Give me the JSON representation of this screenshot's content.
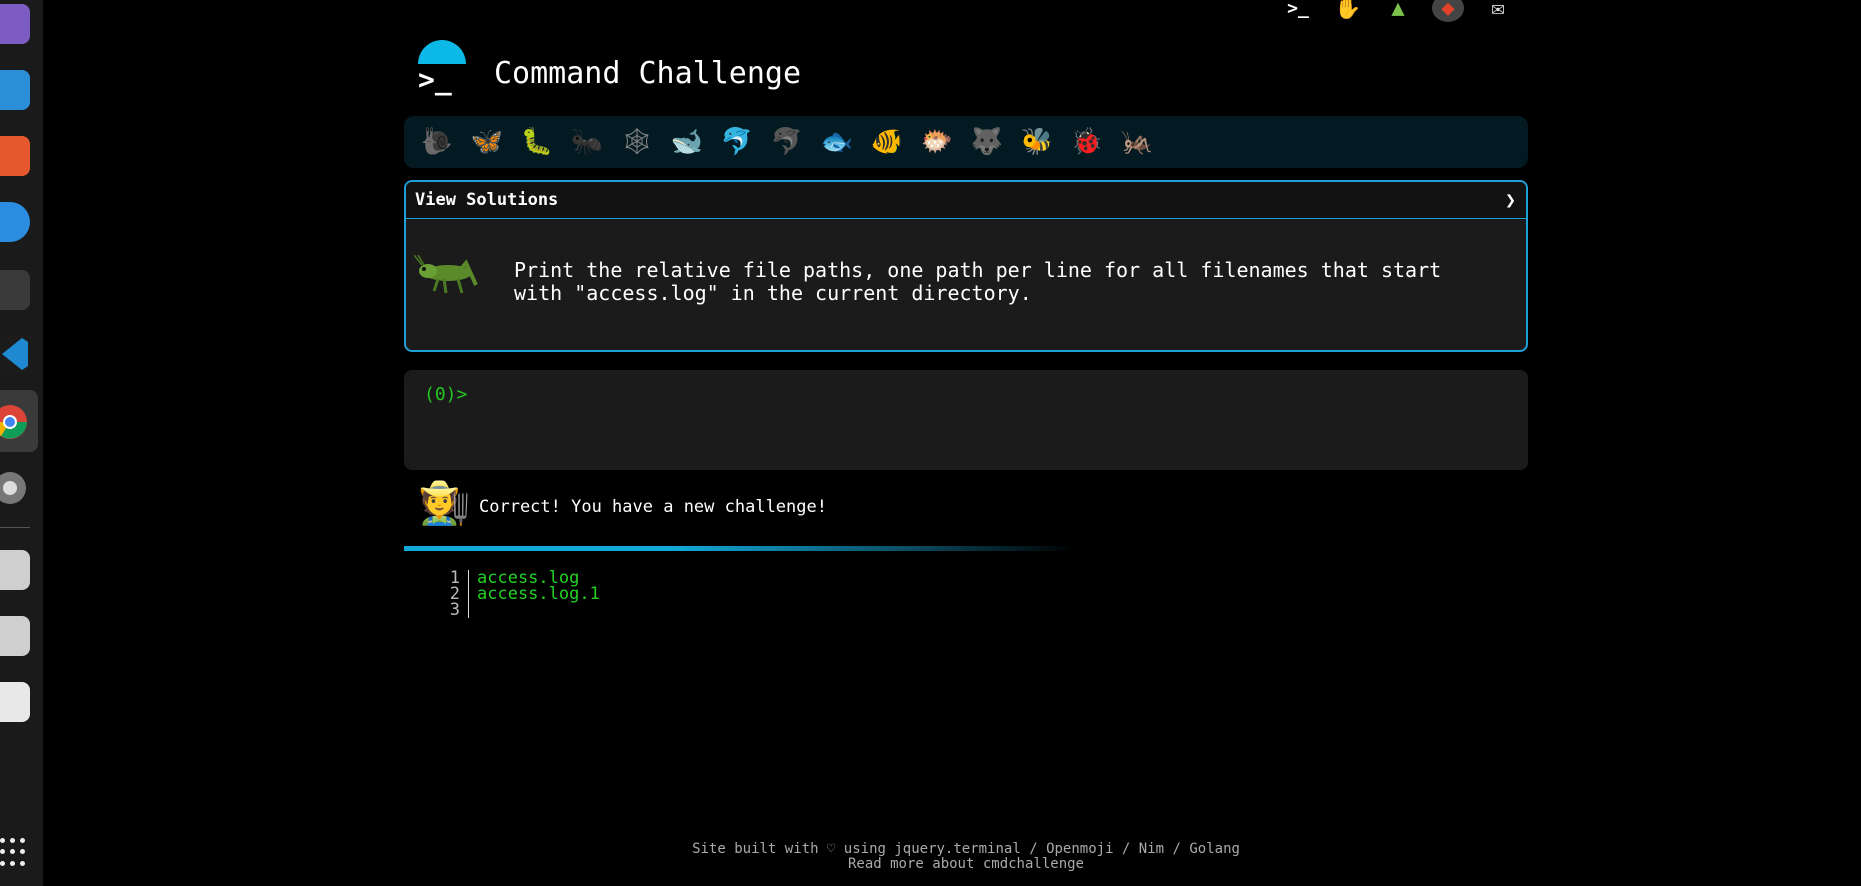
{
  "app": {
    "title": "Command Challenge",
    "logo_prompt": ">_"
  },
  "top_icons": [
    "terminal-icon",
    "hand-icon",
    "tree-icon",
    "gitlab-icon",
    "mail-icon"
  ],
  "emoji_bar": [
    "snail",
    "butterfly",
    "caterpillar",
    "ant",
    "spider-web",
    "whale",
    "dolphin",
    "dolphin",
    "fish",
    "tropical-fish",
    "blowfish",
    "wolf",
    "bee",
    "ladybug",
    "cricket"
  ],
  "panel": {
    "header": "View Solutions",
    "chevron": "❯",
    "task": "Print the relative file paths, one path per line for all filenames that start with \"access.log\" in the current directory."
  },
  "terminal": {
    "prompt": "(0)>"
  },
  "feedback": {
    "message": "Correct! You have a new challenge!"
  },
  "output": {
    "lines": [
      {
        "n": "1",
        "text": "access.log"
      },
      {
        "n": "2",
        "text": "access.log.1"
      },
      {
        "n": "3",
        "text": ""
      }
    ]
  },
  "footer": {
    "line1": "Site built with ♡ using jquery.terminal / Openmoji / Nim / Golang",
    "line2": "Read more about cmdchallenge"
  },
  "colors": {
    "accent": "#1ea0d6",
    "prompt": "#23c623",
    "bg": "#000000"
  }
}
